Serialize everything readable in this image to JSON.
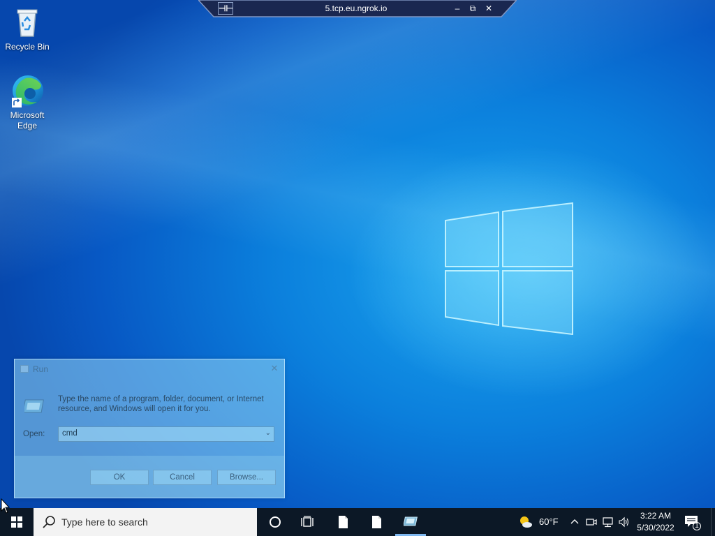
{
  "remote_session": {
    "host": "5.tcp.eu.ngrok.io",
    "pin_label": "⊣⊢",
    "minimize": "–",
    "restore": "⧉",
    "close": "✕"
  },
  "desktop": {
    "icons": [
      {
        "label": "Recycle Bin",
        "icon": "recycle-bin-icon"
      },
      {
        "label": "Microsoft\nEdge",
        "label_line1": "Microsoft",
        "label_line2": "Edge",
        "icon": "edge-icon"
      }
    ]
  },
  "run_dialog": {
    "title": "Run",
    "close": "✕",
    "description": "Type the name of a program, folder, document, or Internet resource, and Windows will open it for you.",
    "open_label": "Open:",
    "open_value": "cmd",
    "dropdown_arrow": "⌄",
    "buttons": {
      "ok": "OK",
      "cancel": "Cancel",
      "browse": "Browse..."
    }
  },
  "taskbar": {
    "search_placeholder": "Type here to search",
    "weather": {
      "temp": "60°F",
      "icon": "partly-sunny-icon"
    },
    "tray_chevron": "^",
    "clock": {
      "time": "3:22 AM",
      "date": "5/30/2022"
    },
    "notification_count": "1",
    "pinned": [
      "cortana-icon",
      "task-view-icon",
      "file-icon",
      "file-icon",
      "run-app-icon"
    ]
  },
  "colors": {
    "wallpaper_center": "#1aa6ef",
    "wallpaper_edge": "#0647ad",
    "taskbar_bg": "#0c1826",
    "search_bg": "#f3f3f3"
  }
}
